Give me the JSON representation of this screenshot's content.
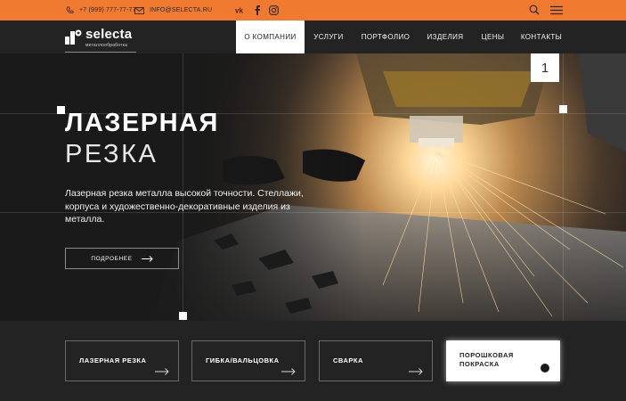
{
  "topbar": {
    "phone": "+7 (999) 777-77-77",
    "email": "INFO@SELECTA.RU",
    "socials": [
      "vk-icon",
      "facebook-icon",
      "instagram-icon"
    ],
    "bg_color": "#f07a2f"
  },
  "logo": {
    "name": "selecta",
    "tagline": "металлообработка"
  },
  "nav": {
    "items": [
      {
        "label": "О КОМПАНИИ",
        "active": true
      },
      {
        "label": "УСЛУГИ",
        "active": false
      },
      {
        "label": "ПОРТФОЛИО",
        "active": false
      },
      {
        "label": "ИЗДЕЛИЯ",
        "active": false
      },
      {
        "label": "ЦЕНЫ",
        "active": false
      },
      {
        "label": "КОНТАКТЫ",
        "active": false
      }
    ]
  },
  "hero": {
    "slide_number": "1",
    "title_line1": "ЛАЗЕРНАЯ",
    "title_line2": "РЕЗКА",
    "description": "Лазерная резка металла высокой точности. Стеллажи, корпуса и художественно-декоративные изделия из металла.",
    "button_label": "ПОДРОБНЕЕ"
  },
  "services": [
    {
      "label": "ЛАЗЕРНАЯ РЕЗКА",
      "active": false
    },
    {
      "label": "ГИБКА/ВАЛЬЦОВКА",
      "active": false
    },
    {
      "label": "СВАРКА",
      "active": false
    },
    {
      "label": "ПОРОШКОВАЯ ПОКРАСКА",
      "active": true
    }
  ]
}
